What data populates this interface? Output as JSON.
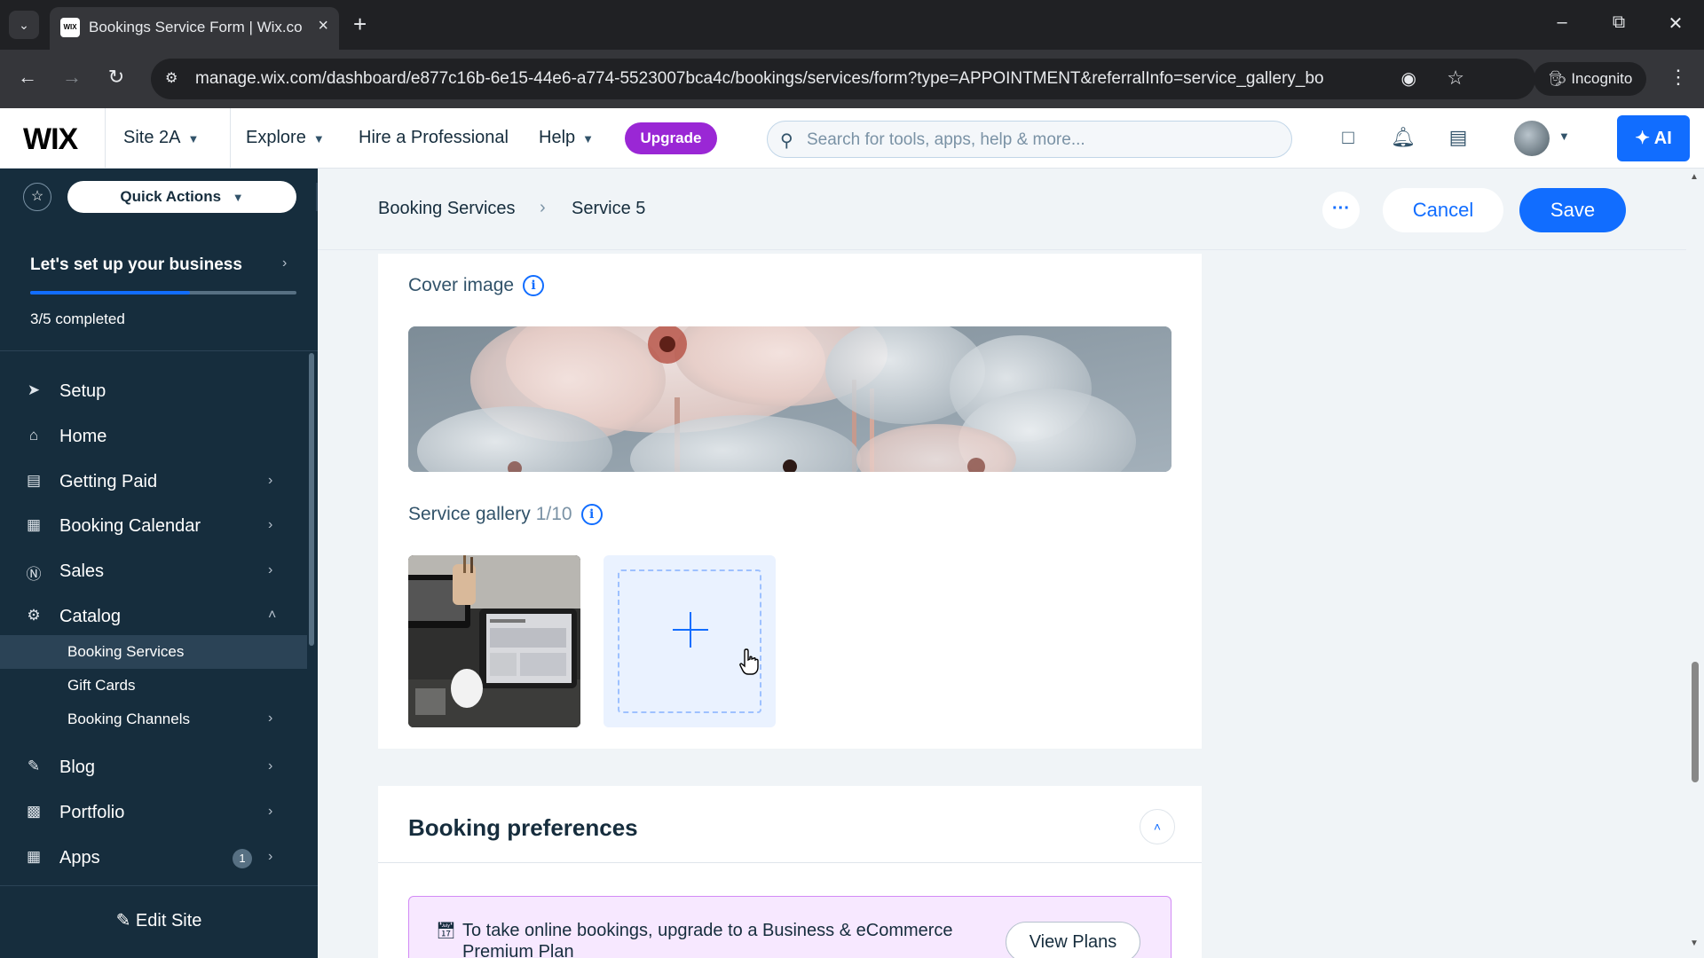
{
  "browser": {
    "tab_title": "Bookings Service Form | Wix.com",
    "favicon_text": "WIX",
    "url": "manage.wix.com/dashboard/e877c16b-6e15-44e6-a774-5523007bca4c/bookings/services/form?type=APPOINTMENT&referralInfo=service_gallery_bo",
    "incognito_label": "Incognito"
  },
  "topbar": {
    "logo": "WIX",
    "site_name": "Site 2A",
    "explore": "Explore",
    "hire": "Hire a Professional",
    "help": "Help",
    "upgrade": "Upgrade",
    "search_placeholder": "Search for tools, apps, help & more...",
    "ai_label": "AI"
  },
  "sidebar": {
    "quick_actions": "Quick Actions",
    "setup_title": "Let's set up your business",
    "setup_progress": "3/5 completed",
    "setup_fraction": 0.6,
    "items": [
      {
        "label": "Setup",
        "icon": "rocket-icon"
      },
      {
        "label": "Home",
        "icon": "home-icon"
      },
      {
        "label": "Getting Paid",
        "icon": "receipt-icon"
      },
      {
        "label": "Booking Calendar",
        "icon": "calendar-icon"
      },
      {
        "label": "Sales",
        "icon": "dollar-icon"
      },
      {
        "label": "Catalog",
        "icon": "catalog-icon"
      },
      {
        "label": "Blog",
        "icon": "pen-icon"
      },
      {
        "label": "Portfolio",
        "icon": "portfolio-icon"
      },
      {
        "label": "Apps",
        "icon": "apps-icon",
        "badge": "1"
      }
    ],
    "catalog_sub": [
      "Booking Services",
      "Gift Cards",
      "Booking Channels"
    ],
    "edit_site": "Edit Site"
  },
  "header": {
    "breadcrumb_root": "Booking Services",
    "breadcrumb_current": "Service 5",
    "more": "···",
    "cancel": "Cancel",
    "save": "Save"
  },
  "media": {
    "cover_label": "Cover image",
    "gallery_label": "Service gallery",
    "gallery_count": "1/10"
  },
  "preferences": {
    "title": "Booking preferences",
    "banner_text": "To take online bookings, upgrade to a Business & eCommerce Premium Plan",
    "view_plans": "View Plans"
  },
  "colors": {
    "accent": "#116dff",
    "sidebar_bg": "#162d3d",
    "upgrade_purple": "#9a27d5"
  }
}
